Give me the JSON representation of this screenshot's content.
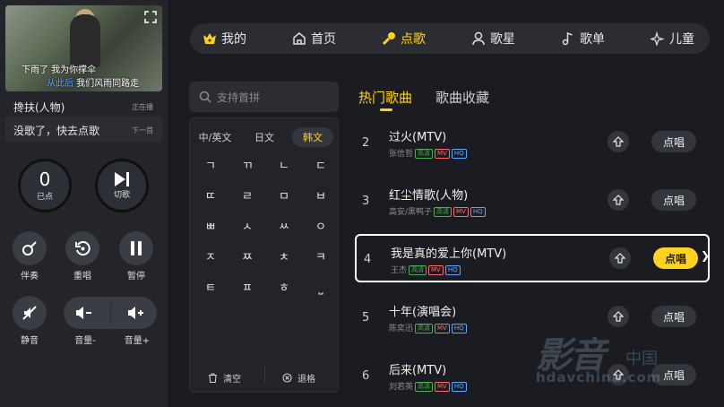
{
  "now_playing": {
    "lyric_line1": "下雨了 我为你撑伞",
    "lyric_line2_hl": "从此后",
    "lyric_line2_rest": " 我们风雨同路走",
    "current_song": "搀扶(人物)",
    "current_status": "正在播",
    "next_song": "没歌了，快去点歌",
    "next_status": "下一首"
  },
  "controls": {
    "ordered_count": "0",
    "ordered_label": "已点",
    "skip_label": "切歌",
    "accompany_label": "伴奏",
    "replay_label": "重唱",
    "pause_label": "暂停",
    "mute_label": "静音",
    "vol_down_label": "音量-",
    "vol_up_label": "音量+"
  },
  "nav": {
    "mine": "我的",
    "home": "首页",
    "order": "点歌",
    "singer": "歌星",
    "playlist": "歌单",
    "kids": "儿童"
  },
  "search": {
    "placeholder": "支持首拼"
  },
  "keyboard": {
    "tabs": [
      "中/英文",
      "日文",
      "韩文"
    ],
    "active_tab": "韩文",
    "keys": [
      "ㄱ",
      "ㄲ",
      "ㄴ",
      "ㄷ",
      "ㄸ",
      "ㄹ",
      "ㅁ",
      "ㅂ",
      "ㅃ",
      "ㅅ",
      "ㅆ",
      "ㅇ",
      "ㅈ",
      "ㅉ",
      "ㅊ",
      "ㅋ",
      "ㅌ",
      "ㅍ",
      "ㅎ",
      "⎵"
    ],
    "clear_label": "清空",
    "backspace_label": "退格"
  },
  "list_tabs": {
    "hot": "热门歌曲",
    "favorites": "歌曲收藏"
  },
  "songs": [
    {
      "index": "2",
      "title": "过火(MTV)",
      "artist": "张信哲",
      "badges": [
        "高清",
        "MV",
        "HQ"
      ]
    },
    {
      "index": "3",
      "title": "红尘情歌(人物)",
      "artist": "高安/黑鸭子",
      "badges": [
        "高清",
        "MV",
        "HQ"
      ]
    },
    {
      "index": "4",
      "title": "我是真的爱上你(MTV)",
      "artist": "王杰",
      "badges": [
        "高清",
        "MV",
        "HQ"
      ]
    },
    {
      "index": "5",
      "title": "十年(演唱会)",
      "artist": "陈奕迅",
      "badges": [
        "高清",
        "MV",
        "HQ"
      ]
    },
    {
      "index": "6",
      "title": "后来(MTV)",
      "artist": "刘若英",
      "badges": [
        "高清",
        "MV",
        "HQ"
      ]
    }
  ],
  "selected_song_index": 2,
  "song_action_label": "点唱",
  "watermark": {
    "big": "影音",
    "small": "中国",
    "url": "hdavchina.com"
  },
  "colors": {
    "accent": "#ffd21f",
    "background": "#1a1c21",
    "panel": "#23252b"
  }
}
